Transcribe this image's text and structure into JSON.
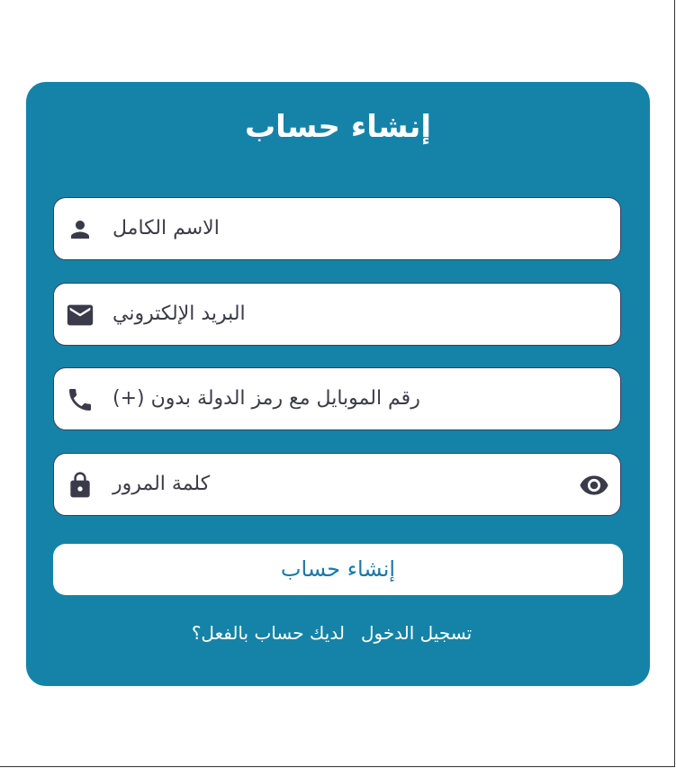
{
  "form": {
    "title": "إنشاء حساب",
    "fields": {
      "full_name": {
        "placeholder": "الاسم الكامل",
        "icon": "person-icon"
      },
      "email": {
        "placeholder": "البريد الإلكتروني",
        "icon": "mail-icon"
      },
      "phone": {
        "placeholder": "رقم الموبايل مع رمز الدولة بدون (+)",
        "icon": "phone-icon"
      },
      "password": {
        "placeholder": "كلمة المرور",
        "icon": "lock-icon",
        "toggle_icon": "eye-icon"
      }
    },
    "submit_label": "إنشاء حساب",
    "footer": {
      "question": "لديك حساب بالفعل؟",
      "login_link": "تسجيل الدخول"
    }
  },
  "colors": {
    "card_background": "#1583a8",
    "button_text": "#1a79a8",
    "field_background": "#ffffff",
    "icon": "#3a3a4a"
  }
}
